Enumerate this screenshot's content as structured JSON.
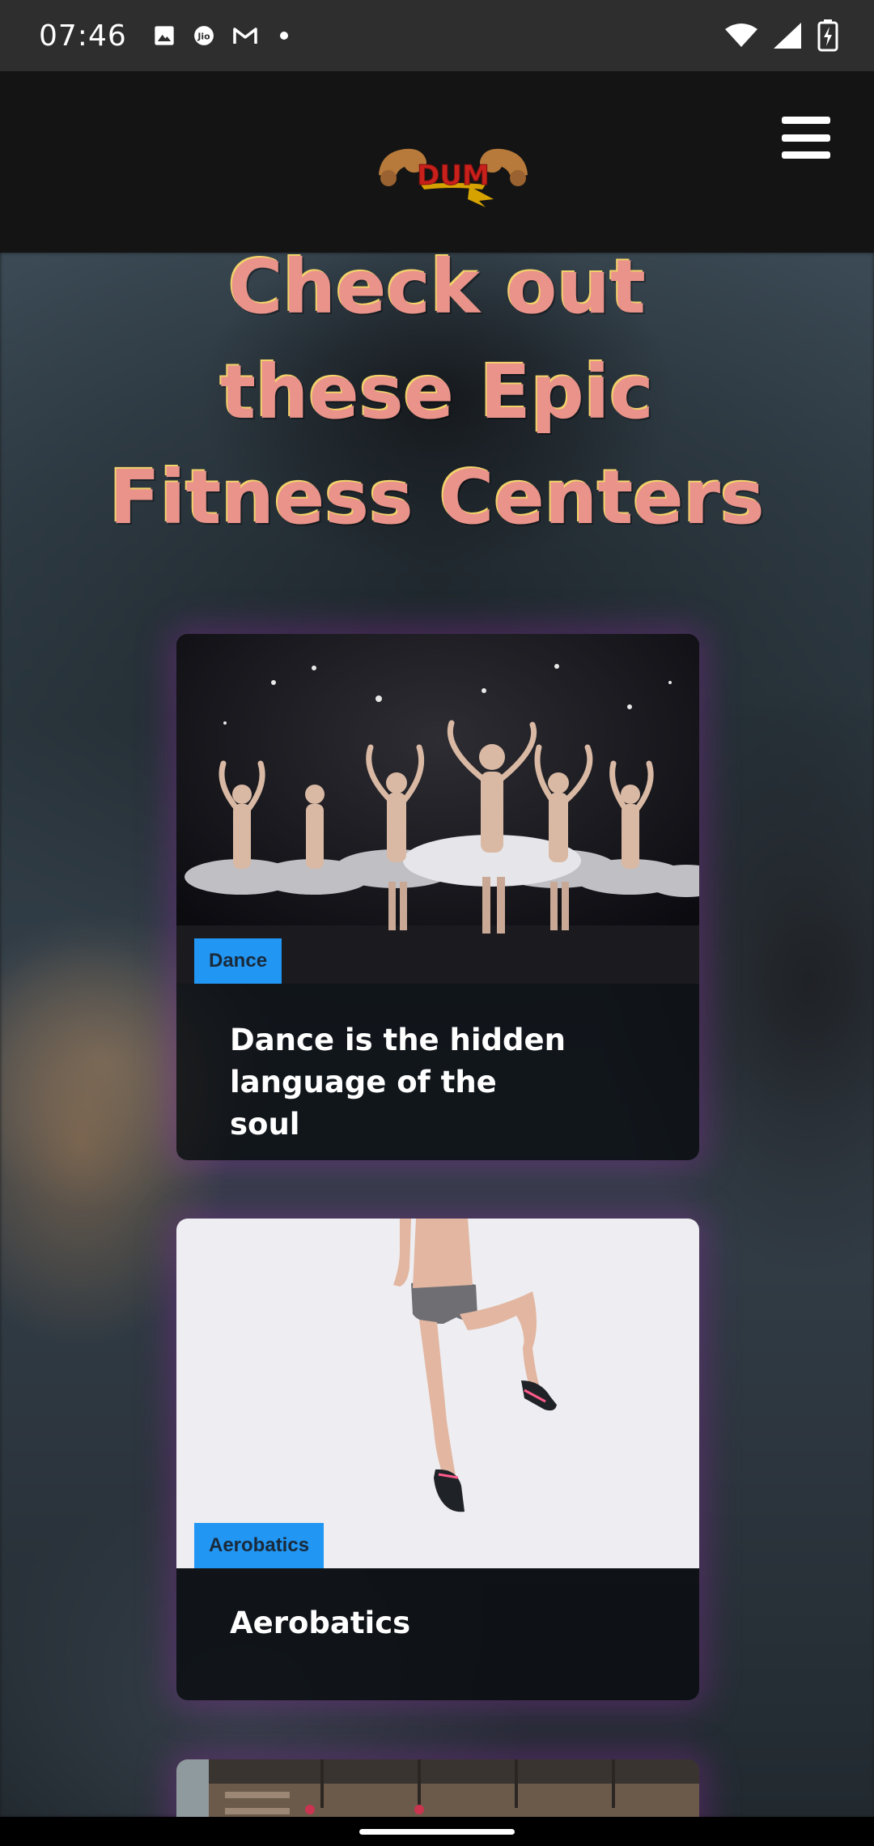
{
  "status_bar": {
    "time": "07:46",
    "left_icons": [
      "gallery-icon",
      "jio-icon",
      "gmail-icon",
      "dot-icon"
    ],
    "right_icons": [
      "wifi-icon",
      "signal-icon",
      "battery-charging-icon"
    ]
  },
  "header": {
    "logo_text": "DUM",
    "menu_icon": "hamburger-menu-icon"
  },
  "hero": {
    "title_line1": "Check out",
    "title_line2": "these Epic",
    "title_line3": "Fitness Centers"
  },
  "cards": [
    {
      "badge": "Dance",
      "title": "Dance is the hidden language of the soul",
      "image": "ballet-dancers-photo"
    },
    {
      "badge": "Aerobatics",
      "title": "Aerobatics",
      "image": "jumping-woman-photo"
    },
    {
      "badge": "",
      "title": "",
      "image": "gym-interior-photo"
    }
  ],
  "colors": {
    "title_fill": "#e9938a",
    "title_outline": "#f2d36a",
    "badge_bg": "#2196f3",
    "card_glow": "#9628aa",
    "header_bg": "#141414"
  }
}
